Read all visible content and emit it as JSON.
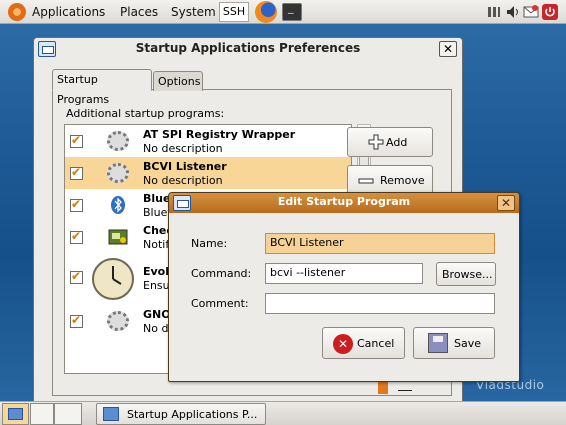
{
  "top_panel": {
    "menus": [
      "Applications",
      "Places",
      "System"
    ],
    "ssh_label": "SSH"
  },
  "taskbar": {
    "task_label": "Startup Applications P..."
  },
  "wallpaper": {
    "brand": "Vladstudio"
  },
  "main_window": {
    "title": "Startup Applications Preferences",
    "close_glyph": "✕",
    "tabs": [
      "Startup Programs",
      "Options"
    ],
    "section_label": "Additional startup programs:",
    "add_label": "Add",
    "remove_label": "Remove",
    "programs": [
      {
        "name": "AT SPI Registry Wrapper",
        "description": "No description",
        "icon": "gears-icon",
        "checked": true
      },
      {
        "name": "BCVI Listener",
        "description": "No description",
        "icon": "gears-icon",
        "checked": true,
        "selected": true
      },
      {
        "name": "Blue",
        "description": "Bluet",
        "icon": "bluetooth-icon",
        "checked": true
      },
      {
        "name": "Chec",
        "description": "Notif",
        "icon": "update-notifier-icon",
        "checked": true
      },
      {
        "name": "Evolu",
        "description": "Ensu",
        "icon": "clock-icon",
        "checked": true
      },
      {
        "name": "GNO",
        "description": "No de",
        "icon": "gears-icon",
        "checked": true
      }
    ]
  },
  "dialog": {
    "title": "Edit Startup Program",
    "name_label": "Name:",
    "name_value": "BCVI Listener",
    "command_label": "Command:",
    "command_value": "bcvi --listener",
    "browse_label": "Browse...",
    "comment_label": "Comment:",
    "comment_value": "",
    "cancel_label": "Cancel",
    "save_label": "Save"
  },
  "colors": {
    "selection": "#f7d698",
    "dialog_titlebar": "#c47d2c",
    "check": "#d1780a"
  }
}
